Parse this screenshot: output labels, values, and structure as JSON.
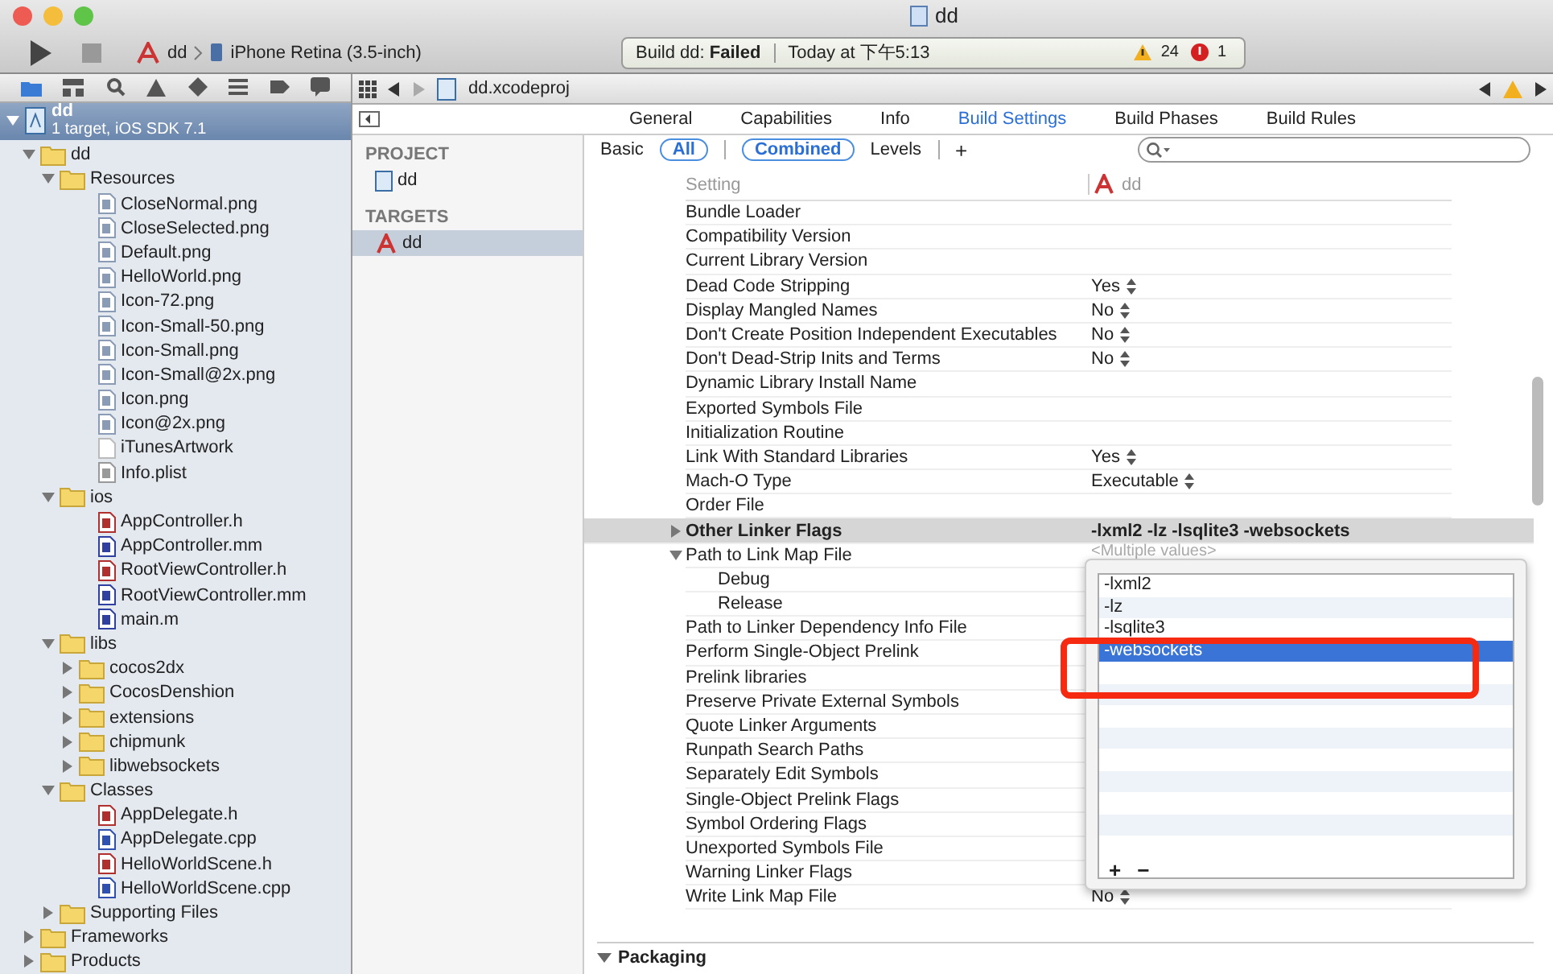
{
  "window": {
    "title": "dd"
  },
  "toolbar": {
    "scheme": "dd",
    "destination": "iPhone Retina (3.5-inch)",
    "activity": {
      "status": "Build dd: **Failed**",
      "time": "Today at 下午5:13",
      "warnings": "24",
      "errors": "1"
    }
  },
  "navigator": {
    "project": {
      "name": "dd",
      "subtitle": "1 target, iOS SDK 7.1",
      "selected": true,
      "expanded": true
    },
    "tree": [
      {
        "name": "dd",
        "kind": "folder",
        "expanded": true,
        "children": [
          {
            "name": "Resources",
            "kind": "folder",
            "expanded": true,
            "children": [
              {
                "name": "CloseNormal.png",
                "kind": "image"
              },
              {
                "name": "CloseSelected.png",
                "kind": "image"
              },
              {
                "name": "Default.png",
                "kind": "image"
              },
              {
                "name": "HelloWorld.png",
                "kind": "image"
              },
              {
                "name": "Icon-72.png",
                "kind": "image"
              },
              {
                "name": "Icon-Small-50.png",
                "kind": "image"
              },
              {
                "name": "Icon-Small.png",
                "kind": "image"
              },
              {
                "name": "Icon-Small@2x.png",
                "kind": "image"
              },
              {
                "name": "Icon.png",
                "kind": "image"
              },
              {
                "name": "Icon@2x.png",
                "kind": "image"
              },
              {
                "name": "iTunesArtwork",
                "kind": "plain"
              },
              {
                "name": "Info.plist",
                "kind": "plist"
              }
            ]
          },
          {
            "name": "ios",
            "kind": "folder",
            "expanded": true,
            "children": [
              {
                "name": "AppController.h",
                "kind": "header"
              },
              {
                "name": "AppController.mm",
                "kind": "objc"
              },
              {
                "name": "RootViewController.h",
                "kind": "header"
              },
              {
                "name": "RootViewController.mm",
                "kind": "objc"
              },
              {
                "name": "main.m",
                "kind": "objc"
              }
            ]
          },
          {
            "name": "libs",
            "kind": "folder",
            "expanded": true,
            "children": [
              {
                "name": "cocos2dx",
                "kind": "folder",
                "expanded": false
              },
              {
                "name": "CocosDenshion",
                "kind": "folder",
                "expanded": false
              },
              {
                "name": "extensions",
                "kind": "folder",
                "expanded": false
              },
              {
                "name": "chipmunk",
                "kind": "folder",
                "expanded": false
              },
              {
                "name": "libwebsockets",
                "kind": "folder",
                "expanded": false
              }
            ]
          },
          {
            "name": "Classes",
            "kind": "folder",
            "expanded": true,
            "children": [
              {
                "name": "AppDelegate.h",
                "kind": "header"
              },
              {
                "name": "AppDelegate.cpp",
                "kind": "cpp"
              },
              {
                "name": "HelloWorldScene.h",
                "kind": "header"
              },
              {
                "name": "HelloWorldScene.cpp",
                "kind": "cpp"
              }
            ]
          },
          {
            "name": "Supporting Files",
            "kind": "folder",
            "expanded": false
          }
        ]
      },
      {
        "name": "Frameworks",
        "kind": "folder",
        "expanded": false
      },
      {
        "name": "Products",
        "kind": "folder",
        "expanded": false
      }
    ]
  },
  "jump_bar": {
    "file": "dd.xcodeproj"
  },
  "editor_tabs": [
    {
      "label": "General",
      "selected": false
    },
    {
      "label": "Capabilities",
      "selected": false
    },
    {
      "label": "Info",
      "selected": false
    },
    {
      "label": "Build Settings",
      "selected": true
    },
    {
      "label": "Build Phases",
      "selected": false
    },
    {
      "label": "Build Rules",
      "selected": false
    }
  ],
  "targets_pane": [
    {
      "heading": "PROJECT",
      "items": [
        {
          "name": "dd",
          "selected": false
        }
      ]
    },
    {
      "heading": "TARGETS",
      "items": [
        {
          "name": "dd",
          "selected": true
        }
      ]
    }
  ],
  "filters": [
    {
      "label": "Basic",
      "kind": "text",
      "selected": false
    },
    {
      "label": "All",
      "kind": "pill",
      "selected": true
    },
    {
      "label": "Combined",
      "kind": "pill",
      "selected": true
    },
    {
      "label": "Levels",
      "kind": "text",
      "selected": false
    }
  ],
  "add_label": "+",
  "settings": {
    "column_setting": "Setting",
    "column_target": "dd",
    "rows": [
      {
        "name": "Bundle Loader"
      },
      {
        "name": "Compatibility Version"
      },
      {
        "name": "Current Library Version"
      },
      {
        "name": "Dead Code Stripping",
        "value": "Yes"
      },
      {
        "name": "Display Mangled Names",
        "value": "No"
      },
      {
        "name": "Don't Create Position Independent Executables",
        "value": "No"
      },
      {
        "name": "Don't Dead-Strip Inits and Terms",
        "value": "No"
      },
      {
        "name": "Dynamic Library Install Name"
      },
      {
        "name": "Exported Symbols File"
      },
      {
        "name": "Initialization Routine"
      },
      {
        "name": "Link With Standard Libraries",
        "value": "Yes"
      },
      {
        "name": "Mach-O Type",
        "value": "Executable"
      },
      {
        "name": "Order File"
      },
      {
        "name": "Other Linker Flags",
        "value": "-lxml2 -lz -lsqlite3 -websockets",
        "highlighted": true,
        "expanded": false,
        "children": []
      },
      {
        "name": "Path to Link Map File",
        "value": "<Multiple values>",
        "multiple": true,
        "expanded": true,
        "children": [
          {
            "name": "Debug"
          },
          {
            "name": "Release"
          }
        ]
      },
      {
        "name": "Path to Linker Dependency Info File"
      },
      {
        "name": "Perform Single-Object Prelink"
      },
      {
        "name": "Prelink libraries"
      },
      {
        "name": "Preserve Private External Symbols"
      },
      {
        "name": "Quote Linker Arguments"
      },
      {
        "name": "Runpath Search Paths"
      },
      {
        "name": "Separately Edit Symbols"
      },
      {
        "name": "Single-Object Prelink Flags"
      },
      {
        "name": "Symbol Ordering Flags"
      },
      {
        "name": "Unexported Symbols File"
      },
      {
        "name": "Warning Linker Flags"
      },
      {
        "name": "Write Link Map File",
        "value": "No"
      }
    ]
  },
  "flags_popover": {
    "items": [
      {
        "text": "-lxml2",
        "selected": false
      },
      {
        "text": "-lz",
        "selected": false
      },
      {
        "text": "-lsqlite3",
        "selected": false
      },
      {
        "text": "-websockets",
        "selected": true
      }
    ],
    "add": "+",
    "remove": "−"
  },
  "packaging": {
    "title": "Packaging",
    "expanded": true
  }
}
